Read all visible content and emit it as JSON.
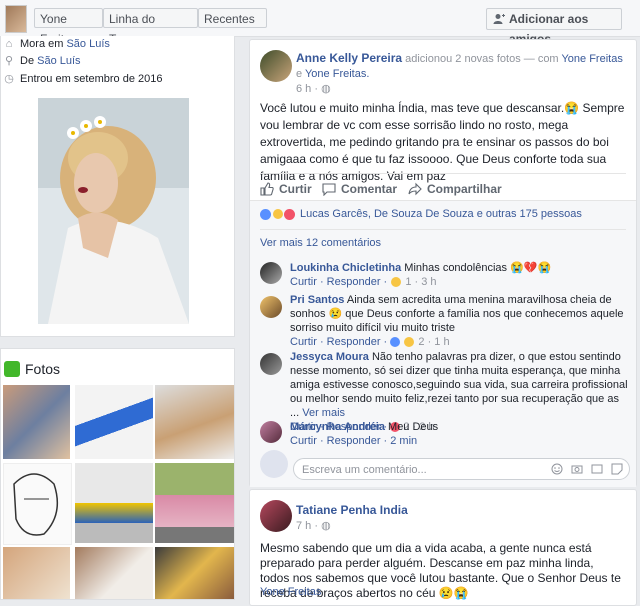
{
  "topbar": {
    "name_button": "Yone Freitas",
    "timeline_button": "Linha do Tempo",
    "recent_button": "Recentes",
    "add_friends": "Adicionar aos amigos"
  },
  "intro": {
    "lives_prefix": "Mora em",
    "lives_city": "São Luís",
    "from_prefix": "De",
    "from_city": "São Luís",
    "joined": "Entrou em setembro de 2016"
  },
  "photos": {
    "title": "Fotos"
  },
  "post1": {
    "author": "Anne Kelly Pereira",
    "action_text": "adicionou 2 novas fotos — com",
    "tagged": "Yone Freitas",
    "and": "e",
    "tagged2": "Yone Freitas.",
    "time": "6 h ·",
    "text": "Você lutou e muito minha Índia, mas teve que descansar.😭 Sempre vou lembrar de vc com esse sorrisão lindo no rosto, mega extrovertida, me pedindo gritando pra te ensinar os passos do boi amigaaa como é que tu faz issoooo. Que Deus conforte toda sua família e a nós amigos. Vai em paz",
    "like": "Curtir",
    "comment": "Comentar",
    "share": "Compartilhar",
    "reactions": "Lucas Garcês, De Souza De Souza e outras 175 pessoas",
    "more_comments": "Ver mais 12 comentários",
    "comments": [
      {
        "author": "Loukinha Chicletinha",
        "text": "Minhas condolências 😭💔😭",
        "reply": "Curtir · Responder ·",
        "count": "1 · 3 h"
      },
      {
        "author": "Pri Santos",
        "text": "Ainda sem acredita uma menina maravilhosa cheia de sonhos 😢 que Deus conforte a família nos que conhecemos aquele sorriso muito difícil viu muito triste",
        "reply": "Curtir · Responder ·",
        "count": "2 · 1 h"
      },
      {
        "author": "Jessyca Moura",
        "text": "Não tenho palavras pra dizer, o que estou sentindo nesse momento, só sei dizer que tinha muita esperança, que minha amiga estivesse conosco,seguindo sua vida, sua carreira profissional ou melhor sendo muito feliz,rezei tanto por sua recuperação que as ...",
        "see_more": "Ver mais",
        "reply": "Curtir · Responder ·",
        "count": "2 · 2 h"
      },
      {
        "author": "Márcynha Andréia",
        "text": "Meu Deus",
        "reply": "Curtir · Responder · 2 min",
        "count": ""
      }
    ],
    "composer_placeholder": "Escreva um comentário..."
  },
  "post2": {
    "author": "Tatiane Penha India",
    "time": "7 h ·",
    "text": "Mesmo sabendo que um dia a vida acaba, a gente nunca está preparado para perder alguém. Descanse em paz minha linda, todos nos sabemos que você lutou bastante. Que o Senhor Deus te receba de braços abertos no céu 😢😭",
    "tag": "Yone Freitas"
  }
}
